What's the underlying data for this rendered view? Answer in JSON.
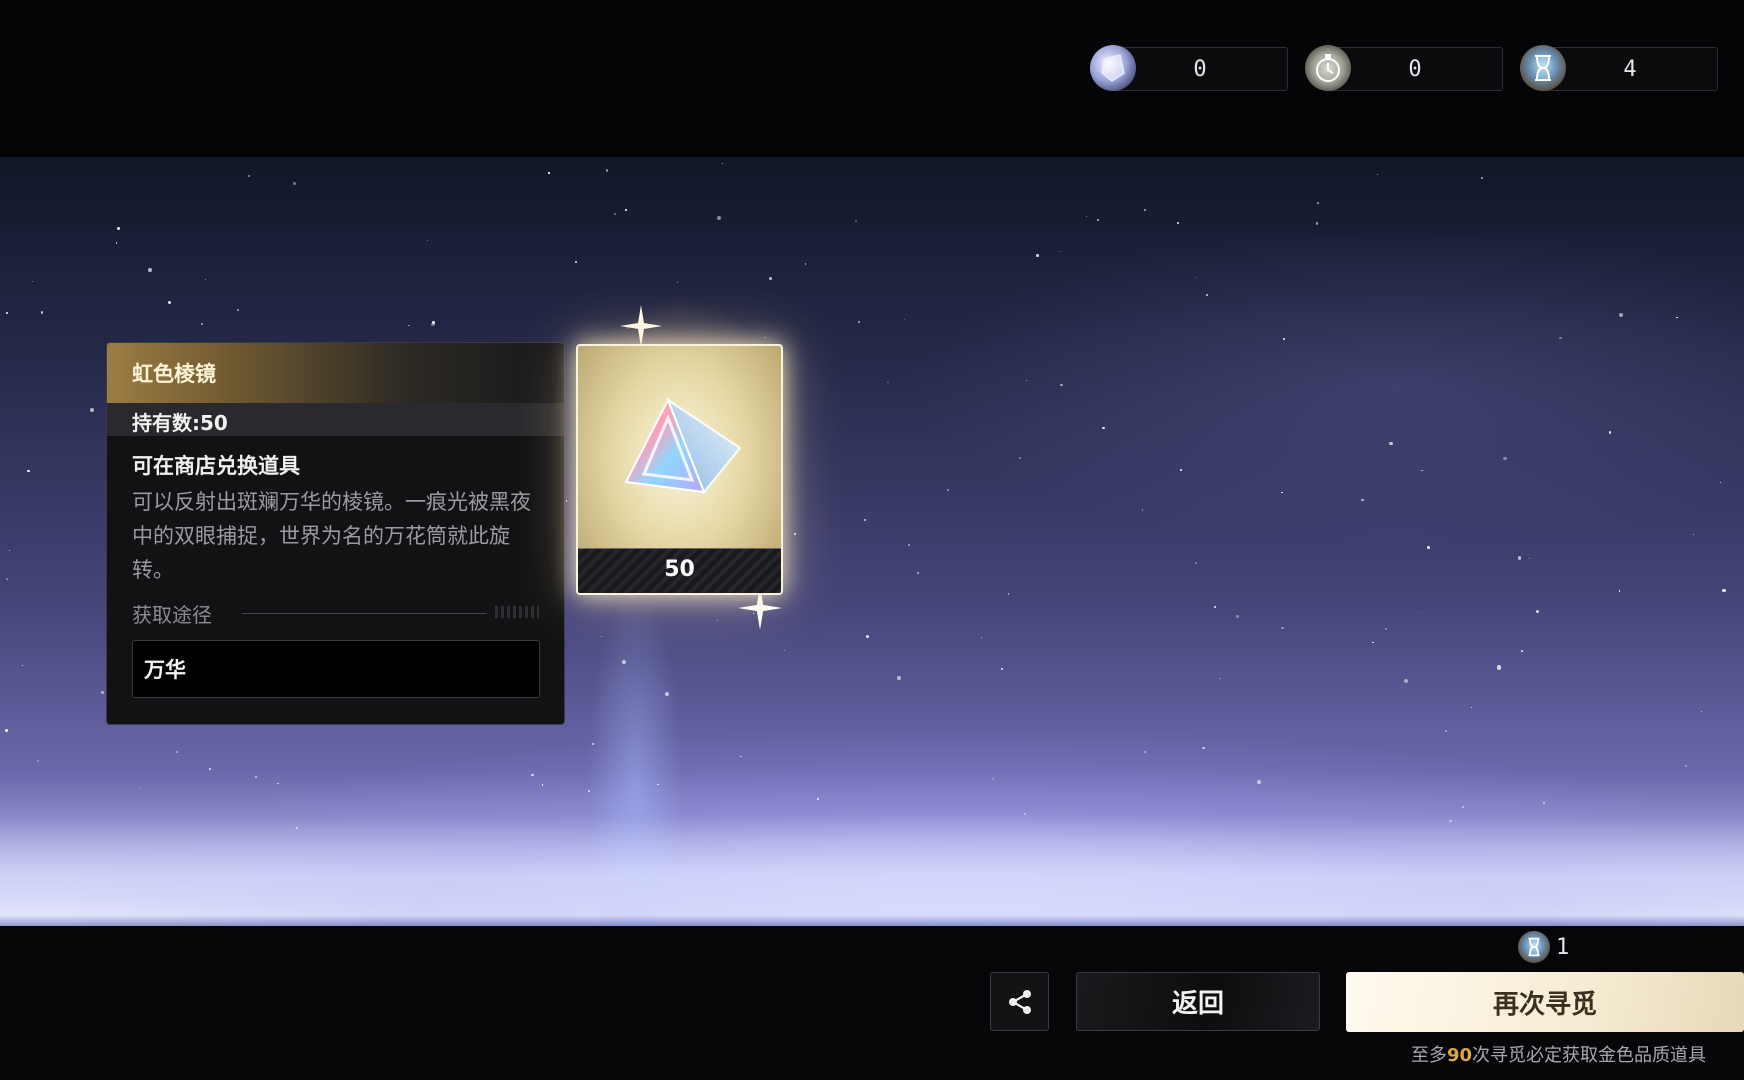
{
  "currencies": [
    {
      "icon": "silver-gem-icon",
      "value": "0"
    },
    {
      "icon": "pocket-watch-icon",
      "value": "0"
    },
    {
      "icon": "hourglass-icon",
      "value": "4"
    }
  ],
  "item_info": {
    "name": "虹色棱镜",
    "owned": "持有数:50",
    "subtitle": "可在商店兑换道具",
    "description": "可以反射出斑斓万华的棱镜。一痕光被黑夜中的双眼捕捉，世界为名的万花筒就此旋转。",
    "source_label": "获取途径",
    "source_value": "万华"
  },
  "item_card": {
    "icon": "rainbow-prism-icon",
    "count": "50"
  },
  "actions": {
    "share_icon": "share-icon",
    "back_label": "返回",
    "again_label": "再次寻觅",
    "cost_icon": "hourglass-icon",
    "cost_value": "1"
  },
  "hint": {
    "prefix": "至多",
    "highlight": "90",
    "suffix": "次寻觅必定获取金色品质道具"
  },
  "colors": {
    "gold_accent": "#d9a64a",
    "card_border": "#f8f2e0",
    "again_button": "#f6ecd3"
  }
}
